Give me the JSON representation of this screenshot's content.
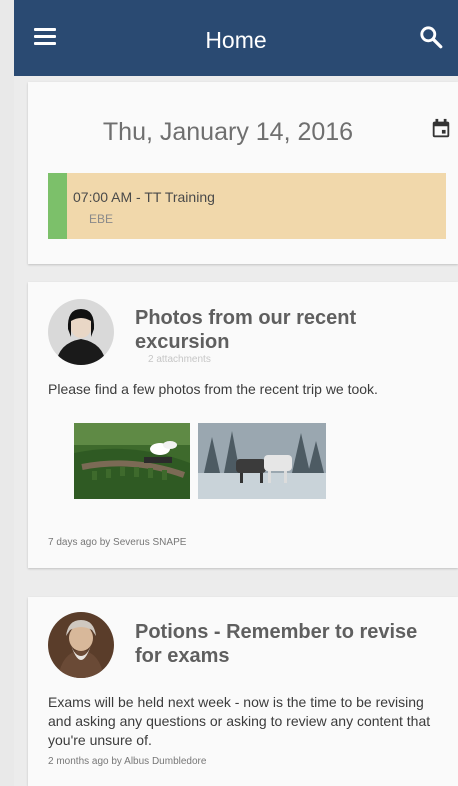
{
  "appbar": {
    "title": "Home",
    "menu_icon": "hamburger-menu-icon",
    "search_icon": "search-icon",
    "color": "#2a4a72"
  },
  "date_card": {
    "date": "Thu, January 14, 2016",
    "calendar_icon": "calendar-icon",
    "event": {
      "time_title": "07:00 AM - TT Training",
      "location": "EBE",
      "bg_color": "#f1d8ab",
      "accent_color": "#7cc06a"
    }
  },
  "posts": [
    {
      "title": "Photos from our recent excursion",
      "attachments": "2 attachments",
      "body": "Please find a few photos from the recent trip we took.",
      "meta": "7 days ago by Severus SNAPE",
      "photos": [
        "viaduct-train-photo",
        "snow-horses-photo"
      ]
    },
    {
      "title": "Potions - Remember to revise for exams",
      "body": "Exams will be held next week - now is the time to be revising and asking any questions or asking to review any content that you're unsure of.",
      "meta": "2 months ago by Albus Dumbledore"
    }
  ]
}
